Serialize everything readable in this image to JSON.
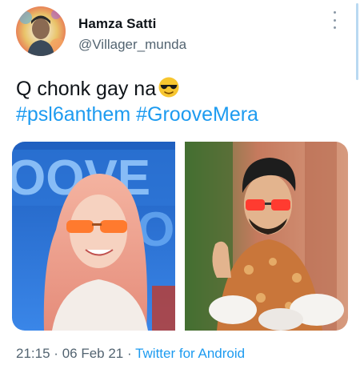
{
  "user": {
    "display_name": "Hamza Satti",
    "handle": "@Villager_munda"
  },
  "tweet": {
    "text": "Q chonk gay na",
    "emoji": "smiling-face-with-sunglasses-icon",
    "hashtags": [
      "#psl6anthem",
      "#GrooveMera"
    ]
  },
  "meta": {
    "time": "21:15",
    "separator": "·",
    "date": "06 Feb 21",
    "source": "Twitter for Android"
  },
  "colors": {
    "text": "#0f1419",
    "secondary": "#536471",
    "link": "#1d9bf0"
  }
}
